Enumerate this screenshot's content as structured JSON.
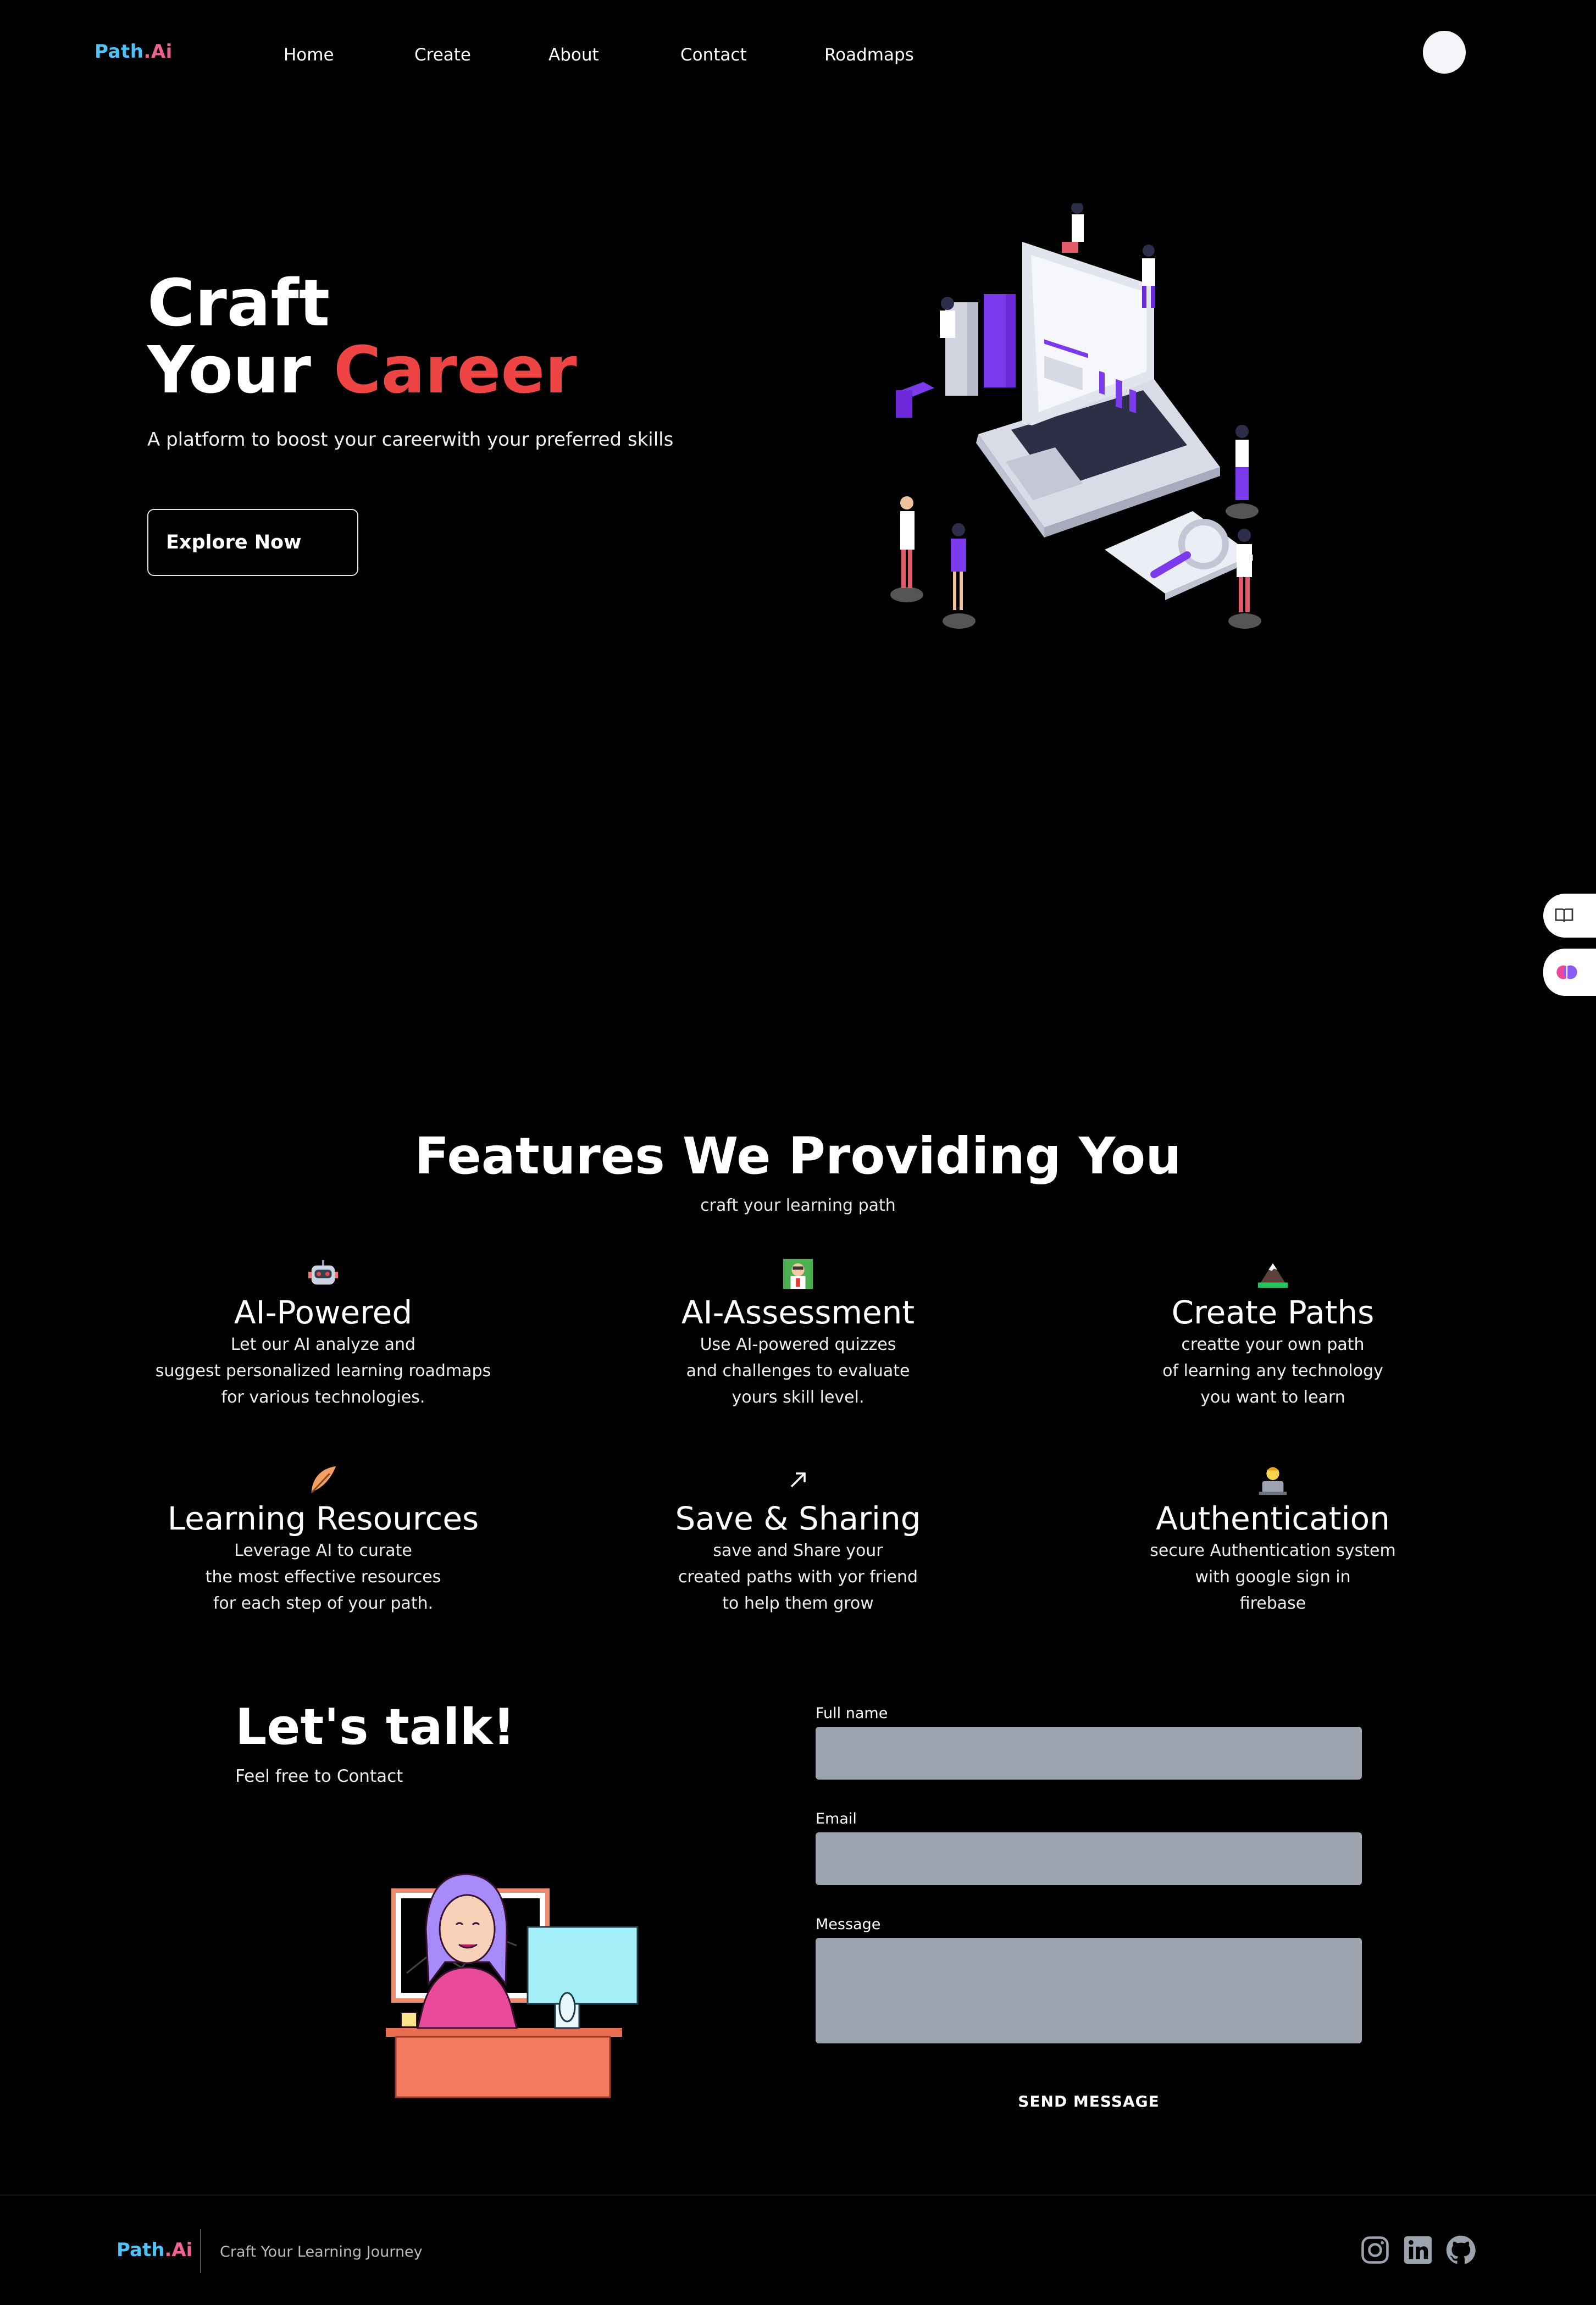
{
  "nav": {
    "logo_main": "Path",
    "logo_dot": ".",
    "logo_suffix": "Ai",
    "links": [
      "Home",
      "Create",
      "About",
      "Contact",
      "Roadmaps"
    ]
  },
  "hero": {
    "title_line1": "Craft",
    "title_line2_a": "Your ",
    "title_line2_b": "Career",
    "subtitle": "A platform to boost your careerwith your preferred skills",
    "cta": "Explore Now"
  },
  "side": {
    "icons": [
      "book-icon",
      "brain-icon"
    ]
  },
  "features": {
    "title": "Features We Providing You",
    "subtitle": "craft your learning path",
    "items": [
      {
        "icon": "robot-icon",
        "title": "AI-Powered",
        "desc": "Let our AI analyze and\nsuggest personalized learning roadmaps\nfor various technologies."
      },
      {
        "icon": "scientist-icon",
        "title": "AI-Assessment",
        "desc": "Use AI-powered quizzes\nand challenges to evaluate\nyours skill level."
      },
      {
        "icon": "mountain-icon",
        "title": "Create Paths",
        "desc": "creatte your own path\nof learning any technology\nyou want to learn"
      },
      {
        "icon": "feather-icon",
        "title": "Learning Resources",
        "desc": "Leverage AI to curate\nthe most effective resources\nfor each step of your path."
      },
      {
        "icon": "arrow-icon",
        "title": "Save & Sharing",
        "desc": "save and Share your\ncreated paths with yor friend\nto help them grow"
      },
      {
        "icon": "technologist-icon",
        "title": "Authentication",
        "desc": "secure Authentication system\nwith google sign in\nfirebase"
      }
    ]
  },
  "contact": {
    "title": "Let's talk!",
    "subtitle": "Feel free to Contact",
    "name_label": "Full name",
    "email_label": "Email",
    "message_label": "Message",
    "send": "SEND MESSAGE"
  },
  "footer": {
    "logo_main": "Path",
    "logo_dot": ".",
    "logo_suffix": "Ai",
    "tagline": "Craft Your Learning Journey",
    "social": [
      "instagram-icon",
      "linkedin-icon",
      "github-icon"
    ]
  },
  "colors": {
    "accent_red": "#ef4444",
    "logo_blue": "#4fc3f7",
    "logo_pink": "#f06292",
    "input_gray": "#9ca3af"
  }
}
